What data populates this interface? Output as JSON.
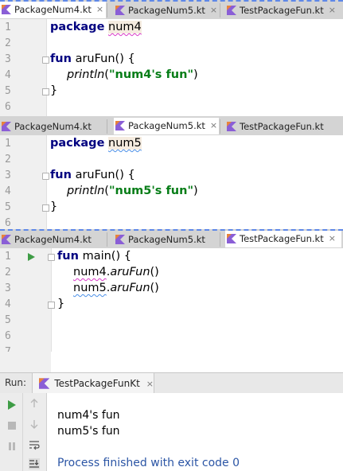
{
  "panes": [
    {
      "tabs": [
        {
          "label": "PackageNum4.kt",
          "active": true,
          "closable": true
        },
        {
          "label": "PackageNum5.kt",
          "active": false,
          "closable": true
        },
        {
          "label": "TestPackageFun.kt",
          "active": false,
          "closable": true
        }
      ],
      "line_numbers": [
        "1",
        "2",
        "3",
        "4",
        "5",
        "6"
      ],
      "code": {
        "l1_kw": "package",
        "l1_name": "num4",
        "l3_kw": "fun",
        "l3_rest": "aruFun() {",
        "l4_fn": "println",
        "l4_open": "(",
        "l4_str": "\"num4's fun\"",
        "l4_close": ")",
        "l5": "}"
      }
    },
    {
      "tabs": [
        {
          "label": "PackageNum4.kt",
          "active": false,
          "closable": false
        },
        {
          "label": "PackageNum5.kt",
          "active": true,
          "closable": true
        },
        {
          "label": "TestPackageFun.kt",
          "active": false,
          "closable": false
        }
      ],
      "line_numbers": [
        "1",
        "2",
        "3",
        "4",
        "5",
        "6"
      ],
      "code": {
        "l1_kw": "package",
        "l1_name": "num5",
        "l3_kw": "fun",
        "l3_rest": "aruFun() {",
        "l4_fn": "println",
        "l4_open": "(",
        "l4_str": "\"num5's fun\"",
        "l4_close": ")",
        "l5": "}"
      }
    },
    {
      "tabs": [
        {
          "label": "PackageNum4.kt",
          "active": false,
          "closable": false
        },
        {
          "label": "PackageNum5.kt",
          "active": false,
          "closable": false
        },
        {
          "label": "TestPackageFun.kt",
          "active": true,
          "closable": true
        }
      ],
      "line_numbers": [
        "1",
        "2",
        "3",
        "4",
        "5",
        "6",
        "7"
      ],
      "code": {
        "l1_kw": "fun",
        "l1_rest": "main() {",
        "l2_pkg": "num4",
        "l2_dot": ".",
        "l2_fn": "aruFun",
        "l2_args": "()",
        "l3_pkg": "num5",
        "l3_dot": ".",
        "l3_fn": "aruFun",
        "l3_args": "()",
        "l4": "}"
      }
    }
  ],
  "run_panel": {
    "label": "Run:",
    "tab_label": "TestPackageFunKt",
    "output": [
      "num4's fun",
      "num5's fun"
    ],
    "exit_message": "Process finished with exit code 0"
  },
  "colors": {
    "keyword": "#000080",
    "string": "#067d17",
    "split_divider": "#5e88e8",
    "run_green": "#3e9c45"
  },
  "close_glyph": "×"
}
